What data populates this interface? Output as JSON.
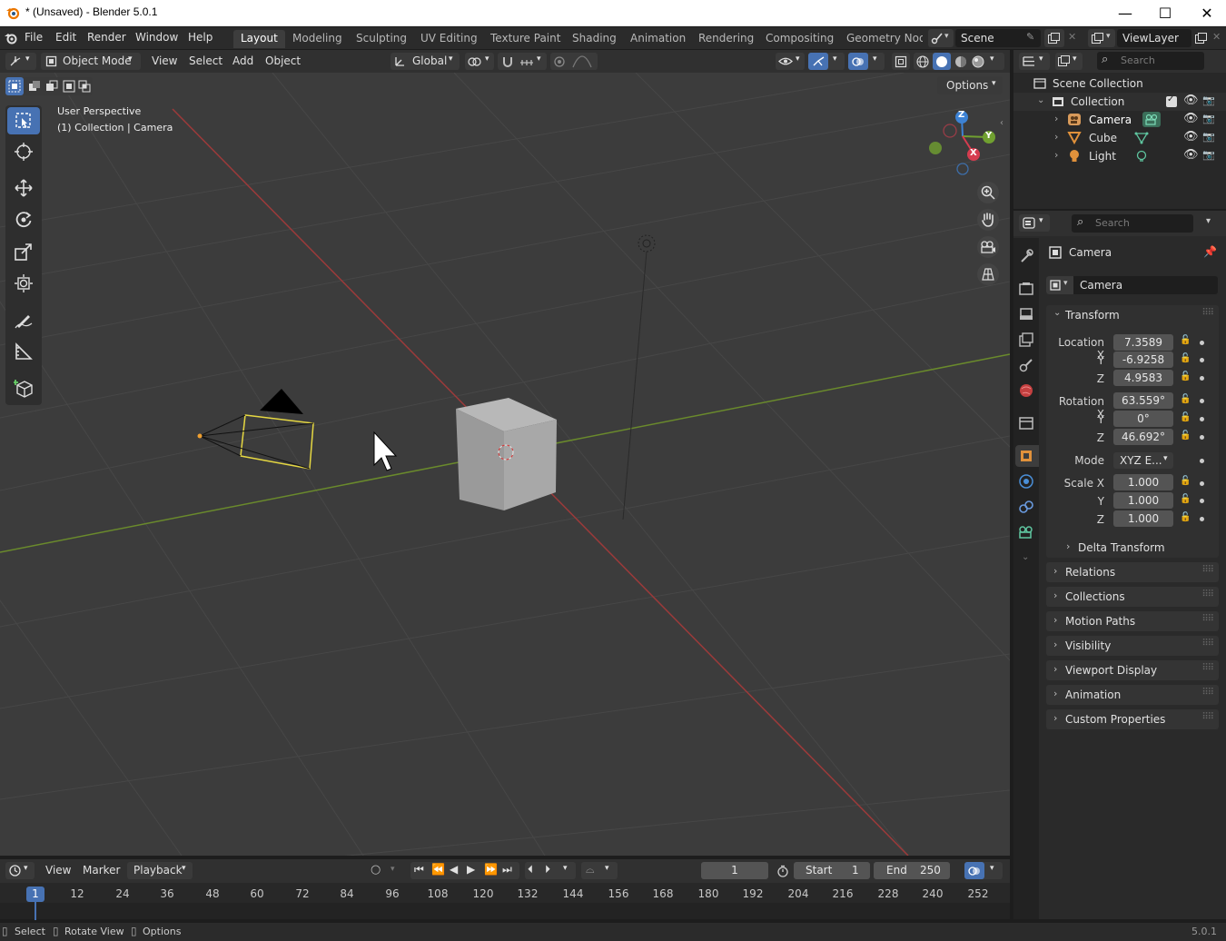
{
  "window": {
    "title": "* (Unsaved) - Blender 5.0.1",
    "minimize": "—",
    "maximize": "☐",
    "close": "✕"
  },
  "menu": [
    "File",
    "Edit",
    "Render",
    "Window",
    "Help"
  ],
  "workspaces": [
    {
      "label": "Layout",
      "active": true
    },
    {
      "label": "Modeling",
      "active": false
    },
    {
      "label": "Sculpting",
      "active": false
    },
    {
      "label": "UV Editing",
      "active": false
    },
    {
      "label": "Texture Paint",
      "active": false
    },
    {
      "label": "Shading",
      "active": false
    },
    {
      "label": "Animation",
      "active": false
    },
    {
      "label": "Rendering",
      "active": false
    },
    {
      "label": "Compositing",
      "active": false
    },
    {
      "label": "Geometry Nod",
      "active": false
    }
  ],
  "scene_name": "Scene",
  "view_layer_name": "ViewLayer",
  "viewport_header": {
    "mode": "Object Mode",
    "menus": [
      "View",
      "Select",
      "Add",
      "Object"
    ],
    "orientation": "Global"
  },
  "viewport": {
    "options_label": "Options",
    "perspective": "User Perspective",
    "context": "(1) Collection | Camera",
    "gizmo": {
      "z": "Z",
      "y": "Y",
      "x": "X"
    }
  },
  "outliner": {
    "search_placeholder": "Search",
    "root": "Scene Collection",
    "collection": "Collection",
    "items": [
      "Camera",
      "Cube",
      "Light"
    ]
  },
  "properties": {
    "search_placeholder": "Search",
    "object_name": "Camera",
    "data_name": "Camera",
    "transform": {
      "header": "Transform",
      "location_label": "Location X",
      "location": [
        "7.3589",
        "-6.9258",
        "4.9583"
      ],
      "rotation_label": "Rotation X",
      "rotation": [
        "63.559°",
        "0°",
        "46.692°"
      ],
      "mode_label": "Mode",
      "mode": "XYZ E...",
      "scale_label": "Scale X",
      "scale": [
        "1.000",
        "1.000",
        "1.000"
      ],
      "y": "Y",
      "z": "Z",
      "delta": "Delta Transform"
    },
    "panels": [
      "Relations",
      "Collections",
      "Motion Paths",
      "Visibility",
      "Viewport Display",
      "Animation",
      "Custom Properties"
    ]
  },
  "timeline": {
    "menus": [
      "View",
      "Marker",
      "Playback"
    ],
    "current_frame": "1",
    "start_label": "Start",
    "start": "1",
    "end_label": "End",
    "end": "250",
    "playhead": "1",
    "ticks": [
      "12",
      "24",
      "36",
      "48",
      "60",
      "72",
      "84",
      "96",
      "108",
      "120",
      "132",
      "144",
      "156",
      "168",
      "180",
      "192",
      "204",
      "216",
      "228",
      "240",
      "252"
    ]
  },
  "status": {
    "select": "Select",
    "rotate": "Rotate View",
    "options": "Options",
    "version": "5.0.1"
  }
}
